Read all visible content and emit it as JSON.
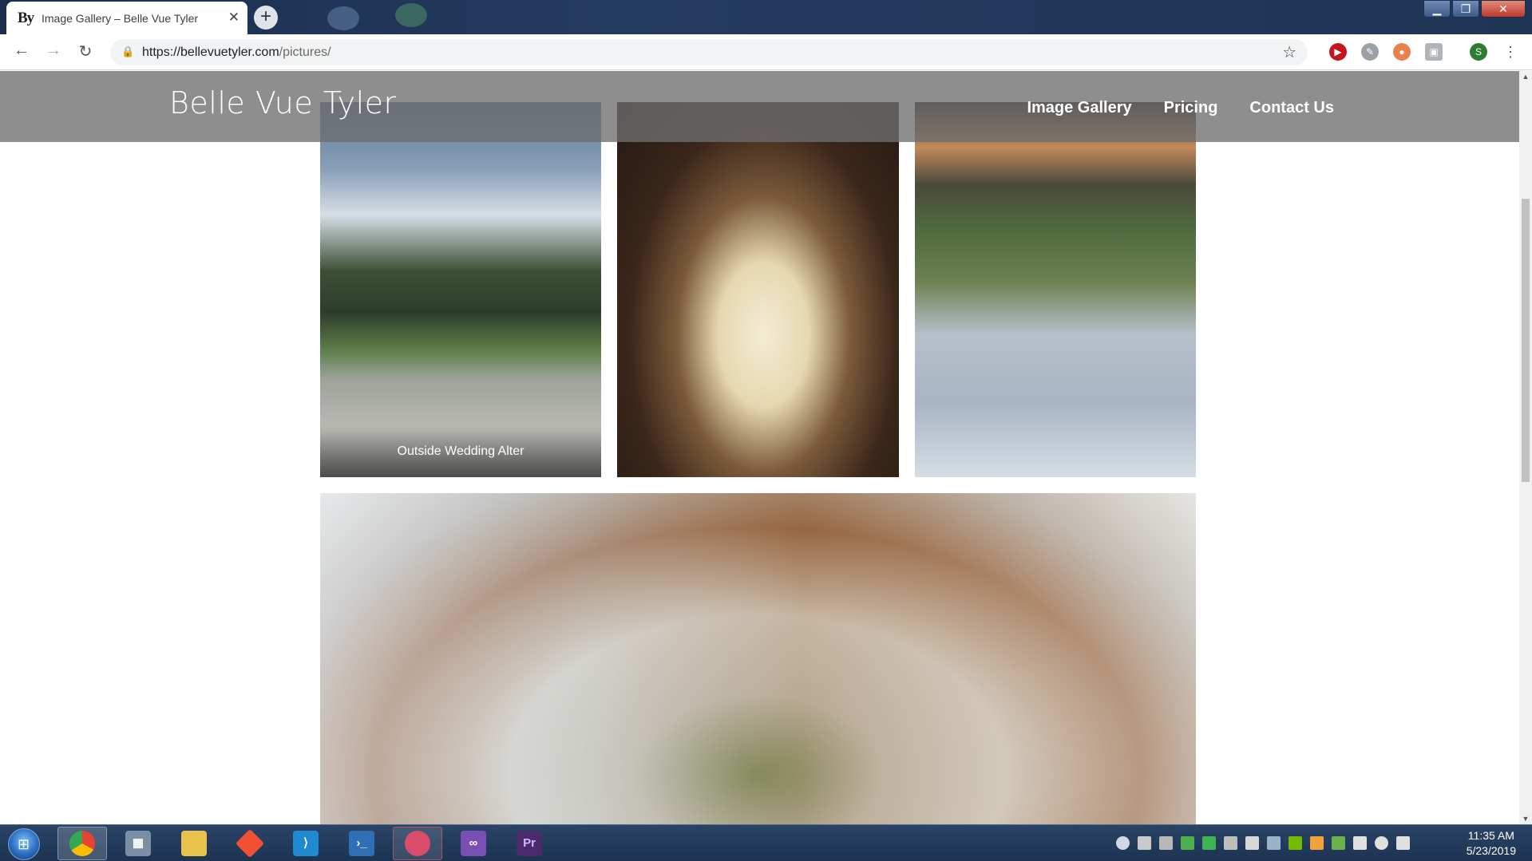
{
  "browser": {
    "tab": {
      "favicon_text": "By",
      "title": "Image Gallery – Belle Vue Tyler",
      "close_glyph": "✕"
    },
    "new_tab_glyph": "+",
    "window_buttons": {
      "minimize": "▁",
      "maximize": "❐",
      "close": "✕"
    },
    "nav": {
      "back": "←",
      "forward": "→",
      "reload": "↻"
    },
    "url_host": "https://bellevuetyler.com",
    "url_path": "/pictures/",
    "bookmark_glyph": "☆",
    "profile_initial": "S"
  },
  "site": {
    "title": "Belle Vue Tyler",
    "nav": [
      {
        "label": "Image Gallery"
      },
      {
        "label": "Pricing"
      },
      {
        "label": "Contact Us"
      }
    ]
  },
  "gallery": {
    "photos": [
      {
        "caption": "Outside Wedding Alter"
      },
      {
        "caption": ""
      },
      {
        "caption": ""
      },
      {
        "caption": ""
      }
    ]
  },
  "taskbar": {
    "apps": [
      {
        "icon": "chrome-icon",
        "color": "#e94235"
      },
      {
        "icon": "calculator-icon",
        "color": "#7a8ea6"
      },
      {
        "icon": "folder-icon",
        "color": "#e8c24a"
      },
      {
        "icon": "git-icon",
        "color": "#f05133"
      },
      {
        "icon": "vscode-icon",
        "color": "#1f8ad2"
      },
      {
        "icon": "powershell-icon",
        "color": "#2f6fb5"
      },
      {
        "icon": "paint-icon",
        "color": "#d94c6a"
      },
      {
        "icon": "visual-studio-icon",
        "color": "#7a4fb3"
      },
      {
        "icon": "premiere-icon",
        "color": "#4b2a6b",
        "label": "Pr"
      }
    ],
    "clock": {
      "time": "11:35 AM",
      "date": "5/23/2019"
    }
  }
}
